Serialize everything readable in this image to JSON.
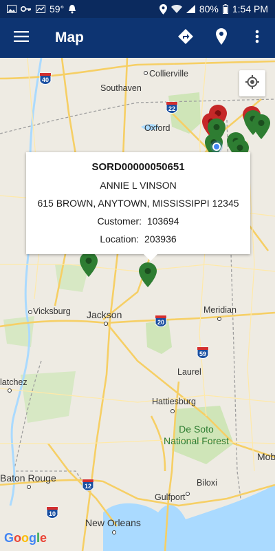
{
  "status_bar": {
    "temperature": "59°",
    "battery": "80%",
    "time": "1:54 PM"
  },
  "app_bar": {
    "title": "Map"
  },
  "info_window": {
    "order_id": "SORD00000050651",
    "name": "ANNIE L VINSON",
    "address": "615 BROWN, ANYTOWN, MISSISSIPPI 12345",
    "customer_label": "Customer:",
    "customer_value": "103694",
    "location_label": "Location:",
    "location_value": "203936"
  },
  "map": {
    "labels": {
      "collierville": "Collierville",
      "southaven": "Southaven",
      "oxford": "Oxford",
      "vicksburg": "Vicksburg",
      "jackson": "Jackson",
      "meridian": "Meridian",
      "laurel": "Laurel",
      "natchez": "latchez",
      "hattiesburg": "Hattiesburg",
      "forest_line1": "De Soto",
      "forest_line2": "National Forest",
      "mobile": "Mob",
      "baton_rouge": "Baton Rouge",
      "biloxi": "Biloxi",
      "gulfport": "Gulfport",
      "new_orleans": "New Orleans"
    },
    "highways": {
      "i40": "40",
      "i22": "22",
      "i20": "20",
      "i59": "59",
      "i12": "12",
      "i10": "10"
    },
    "attribution": [
      "G",
      "o",
      "o",
      "g",
      "l",
      "e"
    ],
    "colors": {
      "pin_green": "#2e7d32",
      "pin_red": "#c62828",
      "app_bar": "#0d3472"
    }
  }
}
